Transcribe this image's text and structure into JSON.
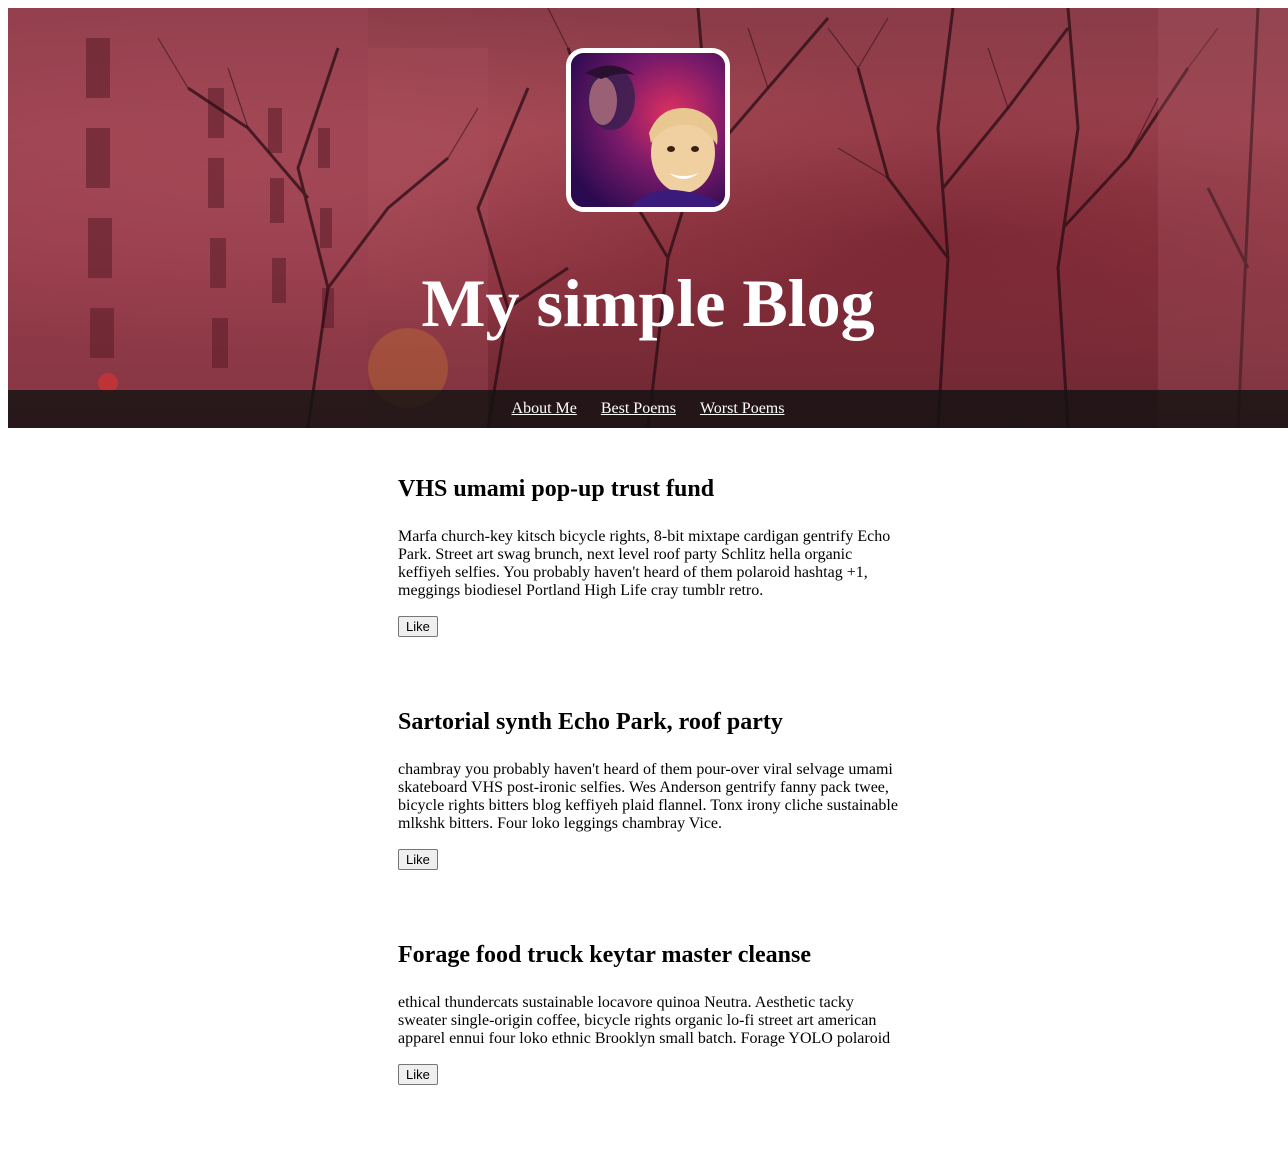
{
  "header": {
    "title": "My simple Blog",
    "avatar_alt": "avatar photo",
    "bg_tint": "#8d3340"
  },
  "nav": {
    "items": [
      {
        "label": "About Me"
      },
      {
        "label": "Best Poems"
      },
      {
        "label": "Worst Poems"
      }
    ]
  },
  "posts": [
    {
      "title": "VHS umami pop-up trust fund",
      "body": "Marfa church-key kitsch bicycle rights, 8-bit mixtape cardigan gentrify Echo Park. Street art swag brunch, next level roof party Schlitz hella organic keffiyeh selfies. You probably haven't heard of them polaroid hashtag +1, meggings biodiesel Portland High Life cray tumblr retro.",
      "like_label": "Like"
    },
    {
      "title": "Sartorial synth Echo Park, roof party",
      "body": "chambray you probably haven't heard of them pour-over viral selvage umami skateboard VHS post-ironic selfies. Wes Anderson gentrify fanny pack twee, bicycle rights bitters blog keffiyeh plaid flannel. Tonx irony cliche sustainable mlkshk bitters. Four loko leggings chambray Vice.",
      "like_label": "Like"
    },
    {
      "title": "Forage food truck keytar master cleanse",
      "body": "ethical thundercats sustainable locavore quinoa Neutra. Aesthetic tacky sweater single-origin coffee, bicycle rights organic lo-fi street art american apparel ennui four loko ethnic Brooklyn small batch. Forage YOLO polaroid",
      "like_label": "Like"
    }
  ]
}
